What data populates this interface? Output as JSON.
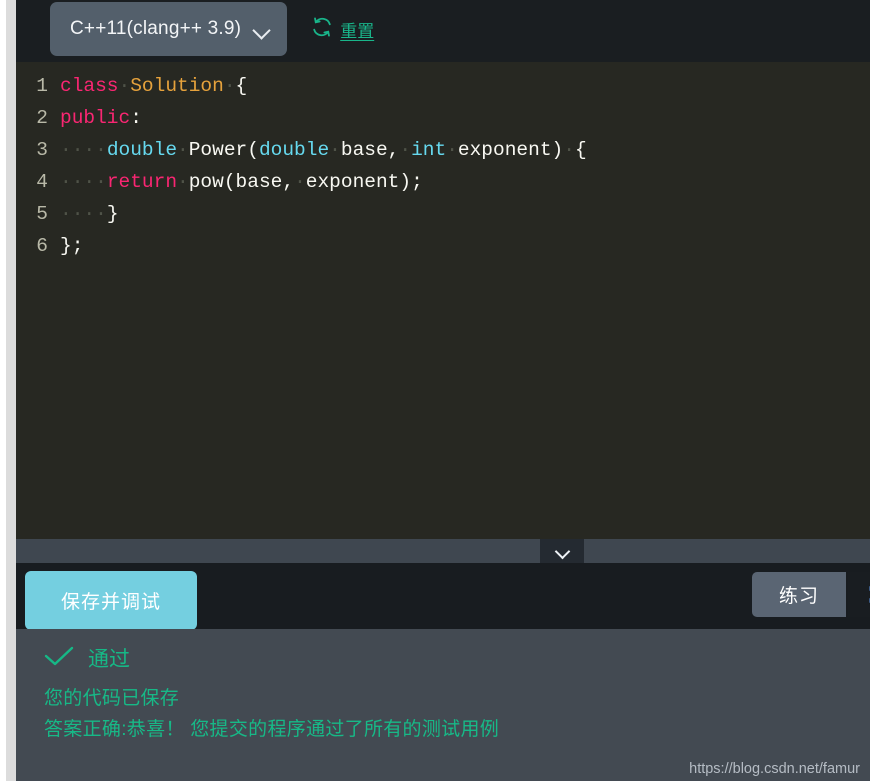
{
  "toolbar": {
    "language_selected": "C++11(clang++ 3.9)",
    "dropdown_icon": "chevron-down-icon",
    "reset_icon": "refresh-icon",
    "reset_label": "重置",
    "reset_color": "#19b58a"
  },
  "editor": {
    "language": "cpp",
    "background": "#272822",
    "lines": [
      {
        "number": "1",
        "tokens": [
          {
            "text": "class",
            "type": "kw"
          },
          {
            "text": "·",
            "type": "ws"
          },
          {
            "text": "Solution",
            "type": "cls"
          },
          {
            "text": "·",
            "type": "ws"
          },
          {
            "text": "{",
            "type": "pl"
          }
        ]
      },
      {
        "number": "2",
        "tokens": [
          {
            "text": "public",
            "type": "kw"
          },
          {
            "text": ":",
            "type": "pl"
          }
        ]
      },
      {
        "number": "3",
        "tokens": [
          {
            "text": "····",
            "type": "ws"
          },
          {
            "text": "double",
            "type": "type"
          },
          {
            "text": "·",
            "type": "ws"
          },
          {
            "text": "Power(",
            "type": "pl"
          },
          {
            "text": "double",
            "type": "type"
          },
          {
            "text": "·",
            "type": "ws"
          },
          {
            "text": "base,",
            "type": "pl"
          },
          {
            "text": "·",
            "type": "ws"
          },
          {
            "text": "int",
            "type": "type"
          },
          {
            "text": "·",
            "type": "ws"
          },
          {
            "text": "exponent)",
            "type": "pl"
          },
          {
            "text": "·",
            "type": "ws"
          },
          {
            "text": "{",
            "type": "pl"
          }
        ]
      },
      {
        "number": "4",
        "tokens": [
          {
            "text": "····",
            "type": "ws"
          },
          {
            "text": "return",
            "type": "kw"
          },
          {
            "text": "·",
            "type": "ws"
          },
          {
            "text": "pow(base,",
            "type": "pl"
          },
          {
            "text": "·",
            "type": "ws"
          },
          {
            "text": "exponent);",
            "type": "pl"
          }
        ]
      },
      {
        "number": "5",
        "tokens": [
          {
            "text": "····",
            "type": "ws"
          },
          {
            "text": "}",
            "type": "pl"
          }
        ]
      },
      {
        "number": "6",
        "tokens": [
          {
            "text": "};",
            "type": "pl"
          }
        ]
      }
    ]
  },
  "splitter": {
    "collapse_icon": "chevron-down-icon"
  },
  "actions": {
    "save_debug_label": "保存并调试",
    "save_debug_color": "#74cfe0",
    "practice_label": "练习"
  },
  "result": {
    "status_icon": "check-icon",
    "status_label": "通过",
    "status_color": "#16b886",
    "messages": [
      "您的代码已保存",
      "答案正确:恭喜！ 您提交的程序通过了所有的测试用例"
    ]
  },
  "watermark": {
    "text": "https://blog.csdn.net/famur"
  }
}
